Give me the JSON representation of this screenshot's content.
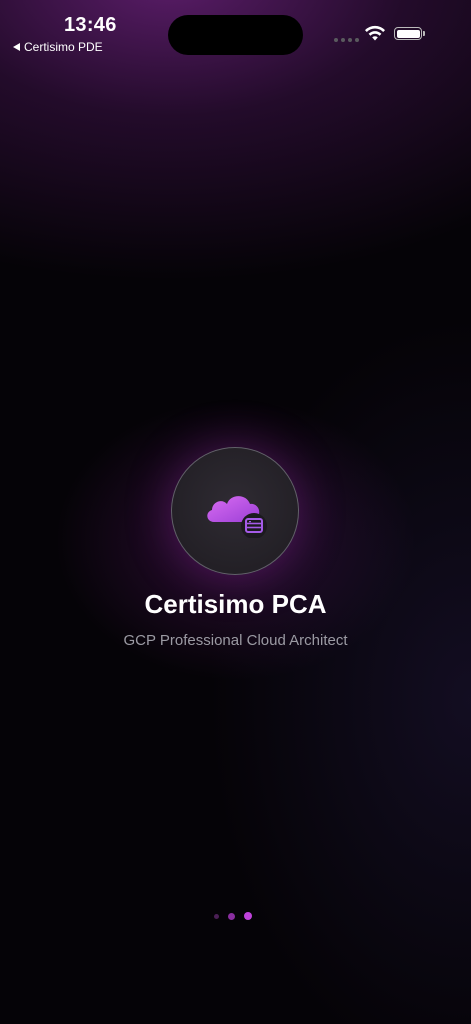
{
  "status_bar": {
    "time": "13:46",
    "back_app": "Certisimo PDE"
  },
  "app": {
    "title": "Certisimo PCA",
    "subtitle": "GCP Professional Cloud Architect",
    "icon": "cloud-server-icon"
  },
  "pager": {
    "total_pages": 3,
    "current_page": 3
  },
  "colors": {
    "accent": "#c043dc",
    "background": "#050307",
    "subtitle_text": "#9b9aa3"
  }
}
